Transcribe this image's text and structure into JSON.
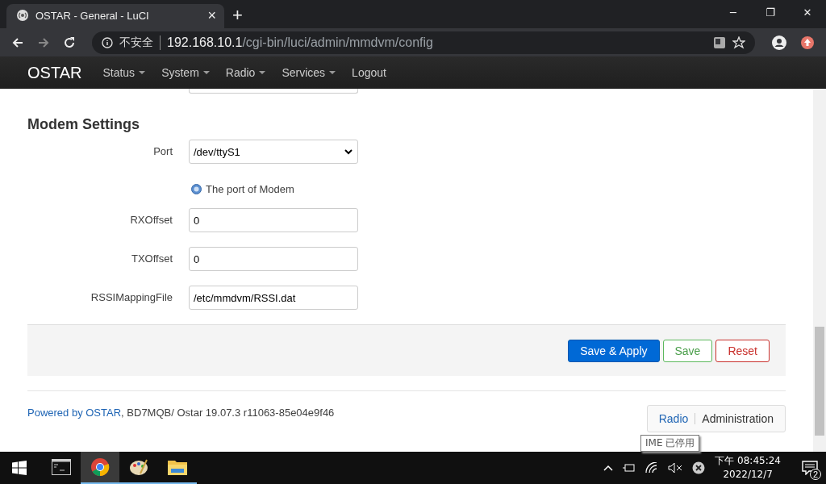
{
  "browser": {
    "tab_title": "OSTAR - General - LuCI",
    "tab_close": "×",
    "new_tab": "+",
    "security": "不安全",
    "host": "192.168.10.1",
    "path": "/cgi-bin/luci/admin/mmdvm/config",
    "window_controls": [
      "─",
      "❐",
      "✕"
    ]
  },
  "nav": {
    "brand": "OSTAR",
    "menus": [
      {
        "label": "Status",
        "dropdown": true
      },
      {
        "label": "System",
        "dropdown": true
      },
      {
        "label": "Radio",
        "dropdown": true
      },
      {
        "label": "Services",
        "dropdown": true
      },
      {
        "label": "Logout",
        "dropdown": false
      }
    ]
  },
  "section": {
    "title": "Modem Settings",
    "fields": [
      {
        "kind": "select",
        "label": "Port",
        "value": "/dev/ttyS1",
        "help": "The port of Modem"
      },
      {
        "kind": "text",
        "label": "RXOffset",
        "value": "0"
      },
      {
        "kind": "text",
        "label": "TXOffset",
        "value": "0"
      },
      {
        "kind": "text",
        "label": "RSSIMappingFile",
        "value": "/etc/mmdvm/RSSI.dat"
      }
    ]
  },
  "actions": [
    {
      "label": "Save & Apply",
      "kind": "primary"
    },
    {
      "label": "Save",
      "kind": "positive"
    },
    {
      "label": "Reset",
      "kind": "negative"
    }
  ],
  "footer": {
    "link": "Powered by OSTAR",
    "text": ", BD7MQB/ Ostar 19.07.3 r11063-85e04e9f46",
    "modes": [
      {
        "label": "Radio",
        "selected": false
      },
      {
        "label": "Administration",
        "selected": true
      }
    ]
  },
  "tooltip": "IME 已停用",
  "taskbar": {
    "apps": [
      {
        "kind": "terminal",
        "selected": false
      },
      {
        "kind": "chrome",
        "selected": true
      },
      {
        "kind": "paint",
        "selected": false
      },
      {
        "kind": "folder",
        "selected": false
      }
    ],
    "time": "下午 08:45:24",
    "date": "2022/12/7",
    "notifications": "2"
  }
}
